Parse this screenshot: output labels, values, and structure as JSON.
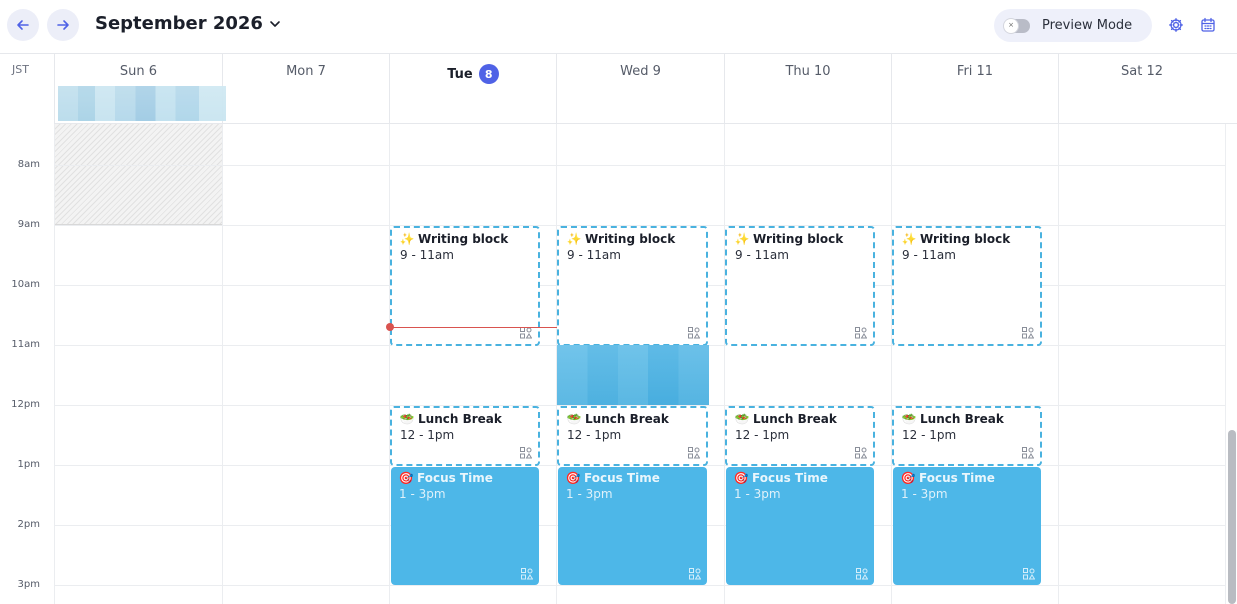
{
  "header": {
    "month_title": "September 2026",
    "preview_mode_label": "Preview Mode",
    "toggle_off_glyph": "×"
  },
  "timezone": "JST",
  "days": [
    {
      "label": "Sun 6",
      "today": false
    },
    {
      "label": "Mon 7",
      "today": false
    },
    {
      "label": "Tue",
      "badge": "8",
      "today": true
    },
    {
      "label": "Wed 9",
      "today": false
    },
    {
      "label": "Thu 10",
      "today": false
    },
    {
      "label": "Fri 11",
      "today": false
    },
    {
      "label": "Sat 12",
      "today": false
    }
  ],
  "time_labels": [
    "8am",
    "9am",
    "10am",
    "11am",
    "12pm",
    "1pm",
    "2pm",
    "3pm"
  ],
  "events": {
    "writing": {
      "emoji": "✨",
      "title": "Writing block",
      "time": "9 - 11am"
    },
    "lunch": {
      "emoji": "🥗",
      "title": "Lunch Break",
      "time": "12 - 1pm"
    },
    "focus": {
      "emoji": "🎯",
      "title": "Focus Time",
      "time": "1 - 3pm"
    }
  },
  "colors": {
    "accent": "#4f62e6",
    "event_blue": "#4db7e8",
    "dashed_border": "#49b2df",
    "now_line": "#d9534f"
  },
  "icons": {
    "prev": "arrow-left-icon",
    "next": "arrow-right-icon",
    "settings": "gear-icon",
    "calendar": "calendar-icon",
    "event_corner": "shapes-icon"
  }
}
